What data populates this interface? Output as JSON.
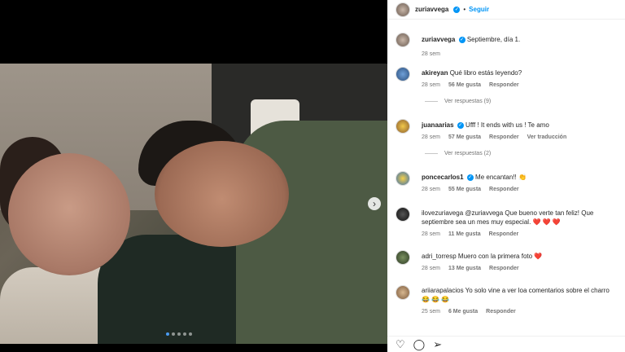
{
  "post": {
    "author": "zuriavvega",
    "follow_label": "Seguir",
    "caption": "Septiembre, día 1.",
    "caption_time": "28 sem"
  },
  "media": {
    "next_icon": "›",
    "slide_count": 5,
    "active_slide": 1
  },
  "comments": [
    {
      "user": "akireyan",
      "text": "Qué libro estás leyendo?",
      "time": "28 sem",
      "likes": "56 Me gusta",
      "reply": "Responder",
      "view_replies": "Ver respuestas (9)",
      "translate": ""
    },
    {
      "user": "juanaarias",
      "text": "Ufff ! It ends with us ! Te amo",
      "time": "28 sem",
      "likes": "57 Me gusta",
      "reply": "Responder",
      "translate": "Ver traducción",
      "view_replies": "Ver respuestas (2)"
    },
    {
      "user": "poncecarlos1",
      "text": "Me encantan!! 👏",
      "time": "28 sem",
      "likes": "55 Me gusta",
      "reply": "Responder",
      "translate": "",
      "view_replies": ""
    },
    {
      "user": "ilovezuriavega",
      "text": "@zuriavvega Que bueno verte tan feliz! Que septiembre sea un mes muy especial. ❤️ ❤️ ❤️",
      "time": "28 sem",
      "likes": "11 Me gusta",
      "reply": "Responder",
      "translate": "",
      "view_replies": ""
    },
    {
      "user": "adri_torresp",
      "text": "Muero con la primera foto ❤️",
      "time": "28 sem",
      "likes": "13 Me gusta",
      "reply": "Responder",
      "translate": "",
      "view_replies": ""
    },
    {
      "user": "ariiarapalacios",
      "text": "Yo solo vine a ver loa comentarios sobre el charro 😂 😂 😂",
      "time": "25 sem",
      "likes": "6 Me gusta",
      "reply": "Responder",
      "translate": "",
      "view_replies": ""
    }
  ],
  "icons": {
    "like": "heart-icon",
    "comment": "comment-icon",
    "share": "share-icon"
  },
  "colors": {
    "accent": "#0095f6",
    "heart": "#ff3040"
  }
}
